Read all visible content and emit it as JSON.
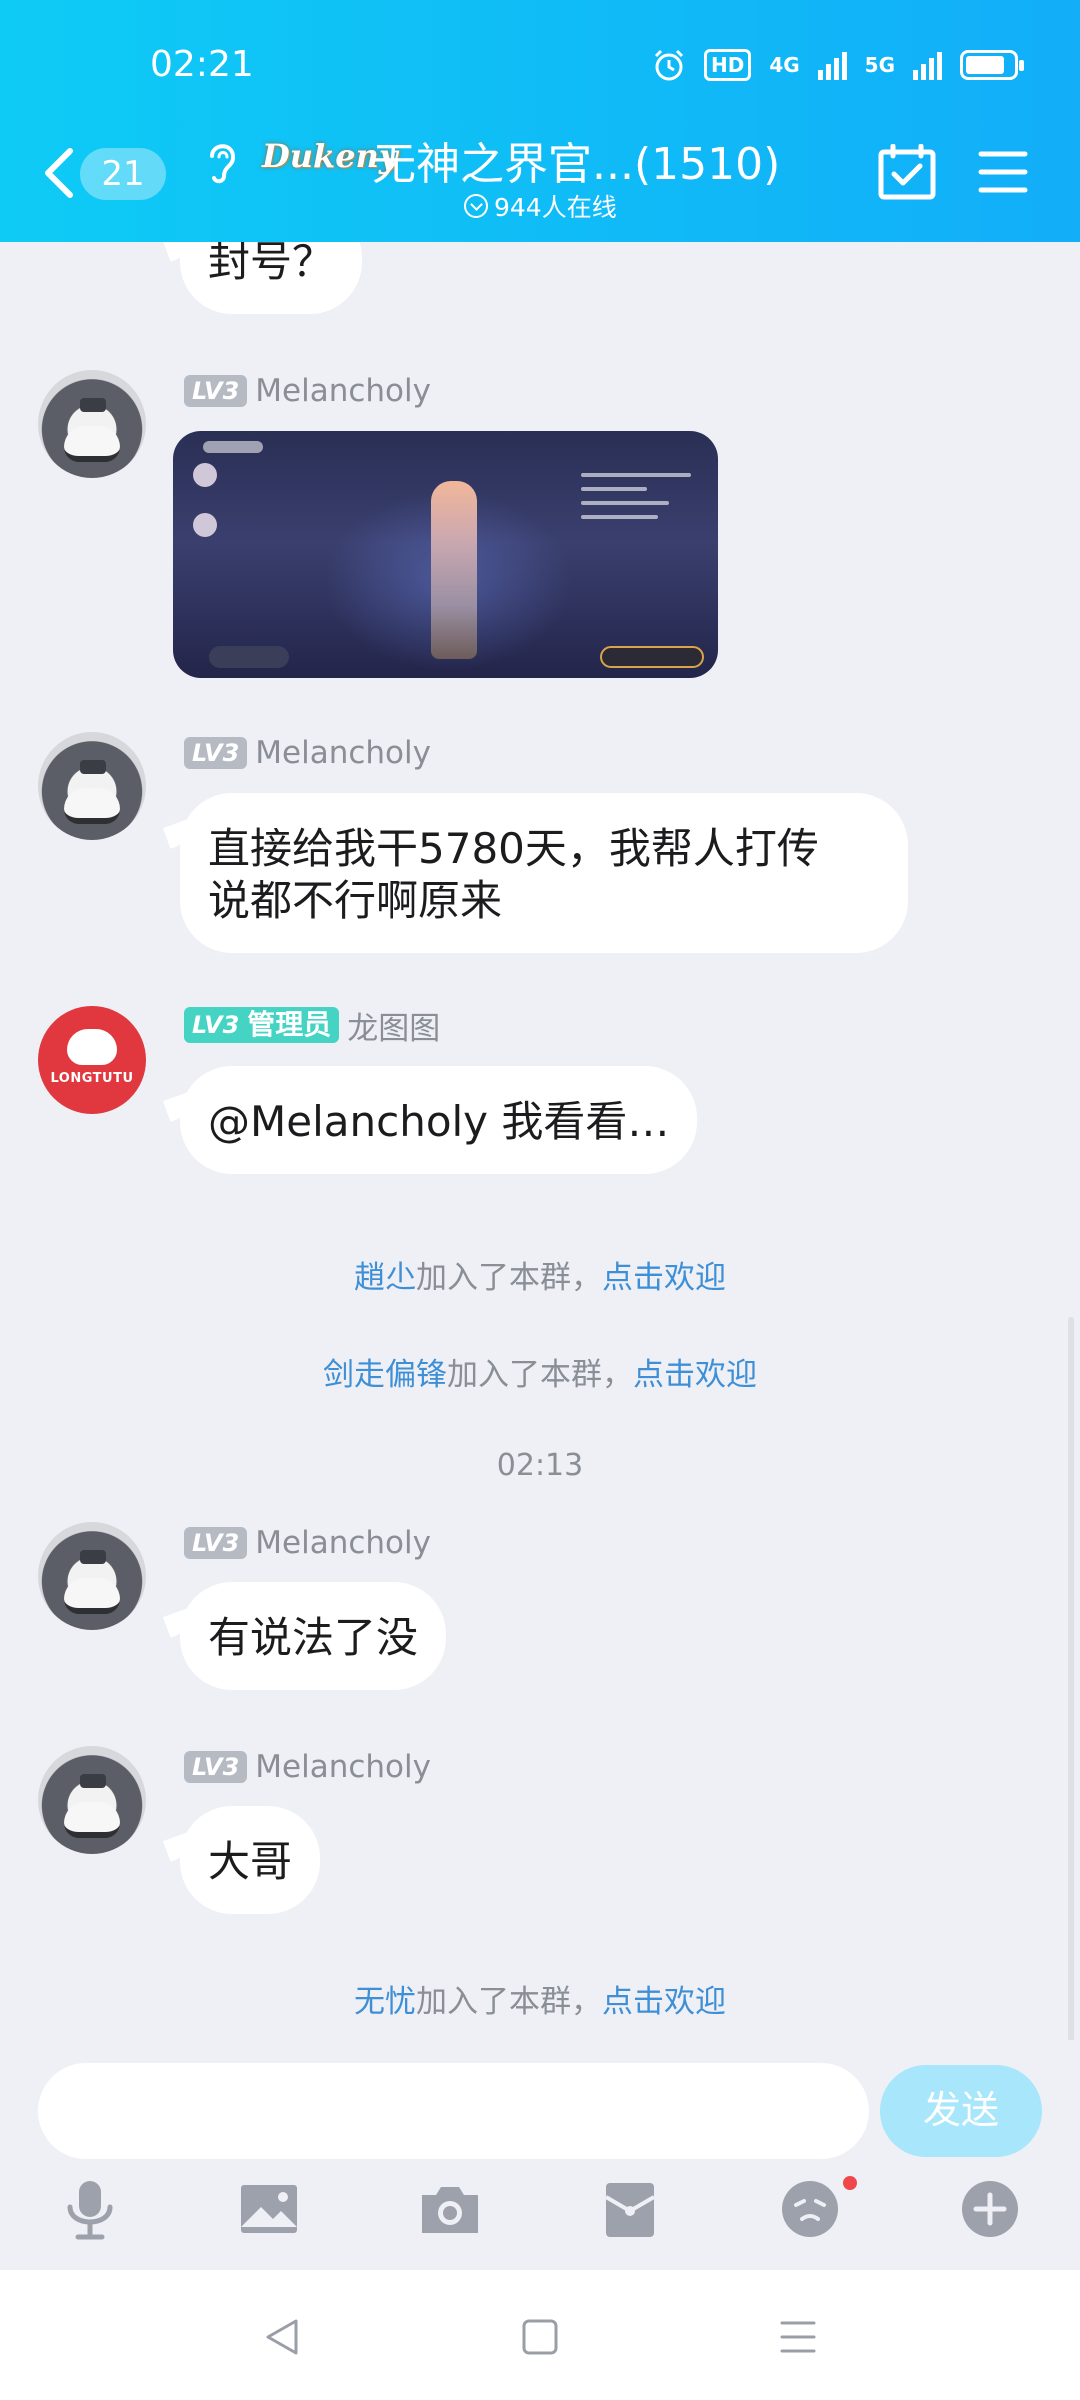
{
  "status_bar": {
    "time": "02:21",
    "hd_label": "HD",
    "net_4g": "4G",
    "net_5g": "5G"
  },
  "header": {
    "unread_count": "21",
    "group_logo_text": "Dukeny",
    "group_title": "无神之界官...(1510)",
    "online_text": "944人在线"
  },
  "messages": [
    {
      "type": "text",
      "text": "封号？"
    },
    {
      "type": "image",
      "level": "LV3",
      "sender": "Melancholy"
    },
    {
      "type": "text",
      "level": "LV3",
      "sender": "Melancholy",
      "text_line1": "直接给我干5780天，我帮人打传",
      "text_line2": "说都不行啊原来"
    },
    {
      "type": "text",
      "level": "LV3",
      "role": "管理员",
      "sender": "龙图图",
      "avatar_text": "LONGTUTU",
      "text": "@Melancholy 我看看…"
    },
    {
      "type": "system",
      "name": "趙尐",
      "joined": "加入了本群，",
      "action": "点击欢迎"
    },
    {
      "type": "system",
      "name": "剑走偏锋",
      "joined": "加入了本群，",
      "action": "点击欢迎"
    },
    {
      "type": "time",
      "text": "02:13"
    },
    {
      "type": "text",
      "level": "LV3",
      "sender": "Melancholy",
      "text": "有说法了没"
    },
    {
      "type": "text",
      "level": "LV3",
      "sender": "Melancholy",
      "text": "大哥"
    },
    {
      "type": "system",
      "name": "无忧",
      "joined": "加入了本群，",
      "action": "点击欢迎"
    }
  ],
  "composer": {
    "input_value": "",
    "send_label": "发送"
  },
  "colors": {
    "header_gradient_start": "#0ecbf5",
    "header_gradient_end": "#12aef8",
    "chat_background": "#eef0f5",
    "link_blue": "#3f8fd6",
    "admin_badge": "#45d3c3",
    "send_button": "#a7e6fb",
    "notification_dot": "#f0484a"
  },
  "icons": {
    "toolbar": [
      "microphone-icon",
      "image-icon",
      "camera-icon",
      "red-packet-icon",
      "emoji-icon",
      "plus-icon"
    ],
    "system_nav": [
      "back-triangle-icon",
      "home-square-icon",
      "recents-lines-icon"
    ]
  }
}
